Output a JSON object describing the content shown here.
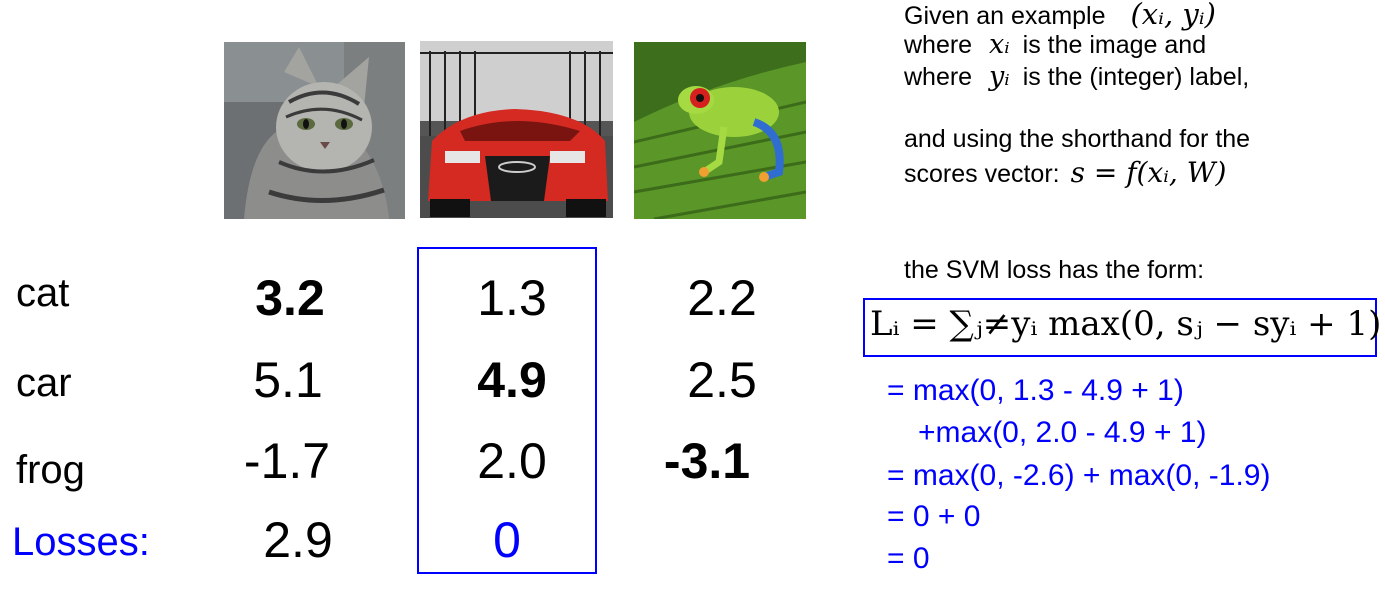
{
  "images": [
    {
      "label": "cat-image"
    },
    {
      "label": "car-image"
    },
    {
      "label": "frog-image"
    }
  ],
  "rows": {
    "cat": {
      "label": "cat",
      "scores": [
        "3.2",
        "1.3",
        "2.2"
      ]
    },
    "car": {
      "label": "car",
      "scores": [
        "5.1",
        "4.9",
        "2.5"
      ]
    },
    "frog": {
      "label": "frog",
      "scores": [
        "-1.7",
        "2.0",
        "-3.1"
      ]
    },
    "losses": {
      "label": "Losses:",
      "values": [
        "2.9",
        "0"
      ]
    }
  },
  "colors": {
    "accent": "#0000ff"
  },
  "explanation": {
    "line1_pre": "Given an example",
    "line1_math": "(xᵢ, yᵢ)",
    "line2_pre": "where",
    "line2_math": "xᵢ",
    "line2_post": "is the image and",
    "line3_pre": "where",
    "line3_math": "yᵢ",
    "line3_post": "is the (integer) label,",
    "line4": "and using the shorthand for the",
    "line5_pre": "scores vector:",
    "line5_math": "s = f(xᵢ, W)",
    "line6": "the SVM loss has the form:",
    "formula": "Lᵢ = ∑ⱼ≠yᵢ max(0, sⱼ − syᵢ + 1)"
  },
  "calculation": [
    "= max(0, 1.3 - 4.9 + 1)",
    "+max(0, 2.0 - 4.9 + 1)",
    "= max(0, -2.6) + max(0, -1.9)",
    "= 0 + 0",
    "= 0"
  ]
}
